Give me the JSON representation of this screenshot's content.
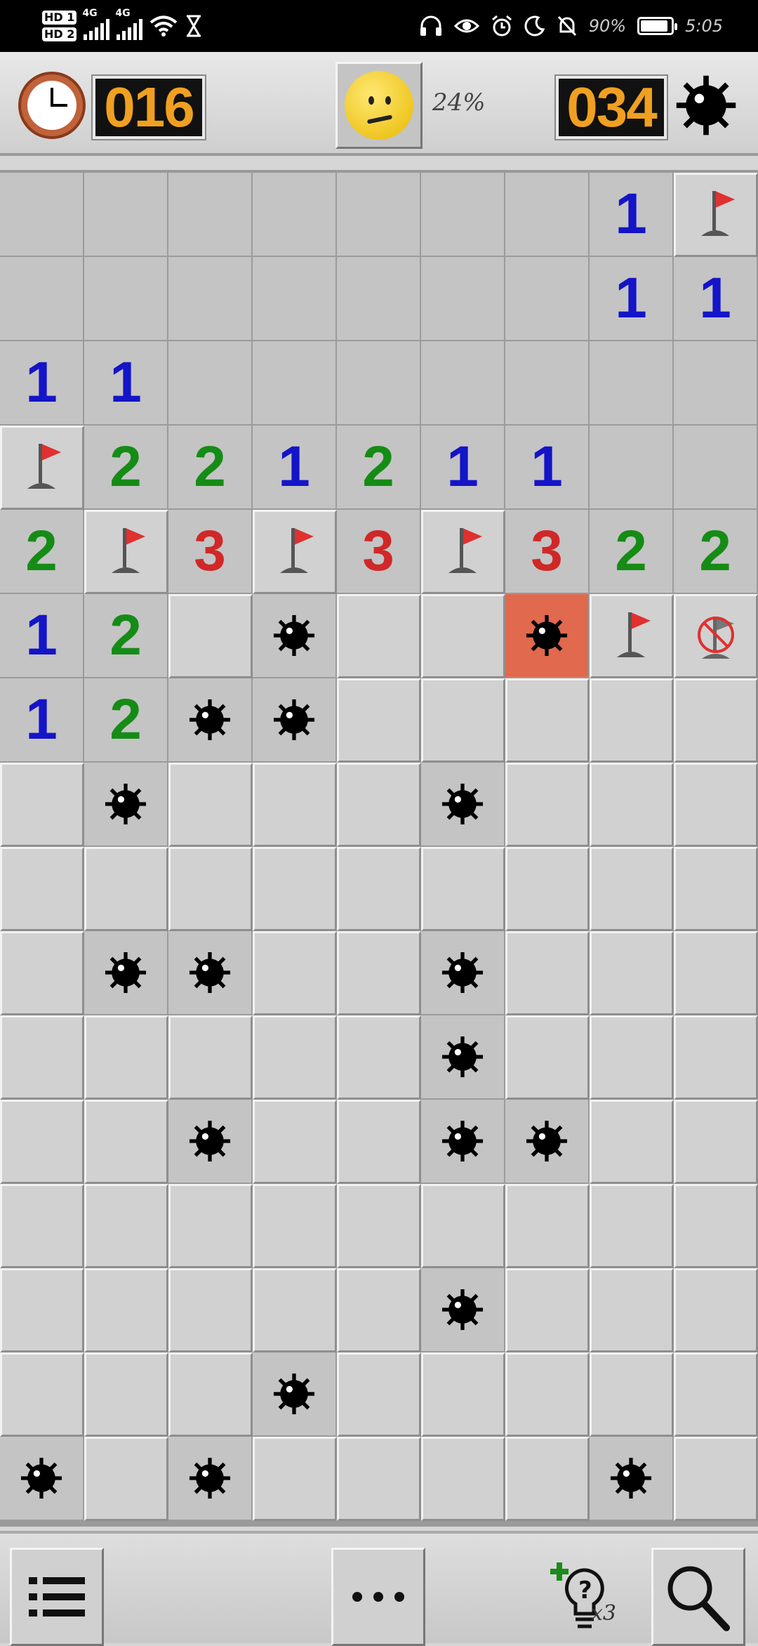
{
  "status_bar": {
    "hd1": "HD 1",
    "hd2": "HD 2",
    "net1": "4G",
    "net2": "4G",
    "battery_pct": "90%",
    "battery_level": 0.9,
    "time": "5:05"
  },
  "header": {
    "timer": "016",
    "progress": "24%",
    "mines_left": "034",
    "face_state": "worried"
  },
  "board": {
    "cols": 9,
    "rows": 16,
    "grid": [
      [
        "E",
        "E",
        "E",
        "E",
        "E",
        "E",
        "E",
        "1",
        "F"
      ],
      [
        "E",
        "E",
        "E",
        "E",
        "E",
        "E",
        "E",
        "1",
        "1"
      ],
      [
        "1",
        "1",
        "E",
        "E",
        "E",
        "E",
        "E",
        "E",
        "E"
      ],
      [
        "F",
        "2",
        "2",
        "1",
        "2",
        "1",
        "1",
        "E",
        "E"
      ],
      [
        "2",
        "F",
        "3",
        "F",
        "3",
        "F",
        "3",
        "2",
        "2"
      ],
      [
        "1",
        "2",
        "C",
        "M",
        "C",
        "C",
        "X",
        "F",
        "W"
      ],
      [
        "1",
        "2",
        "M",
        "M",
        "C",
        "C",
        "C",
        "C",
        "C"
      ],
      [
        "C",
        "M",
        "C",
        "C",
        "C",
        "M",
        "C",
        "C",
        "C"
      ],
      [
        "C",
        "C",
        "C",
        "C",
        "C",
        "C",
        "C",
        "C",
        "C"
      ],
      [
        "C",
        "M",
        "M",
        "C",
        "C",
        "M",
        "C",
        "C",
        "C"
      ],
      [
        "C",
        "C",
        "C",
        "C",
        "C",
        "M",
        "C",
        "C",
        "C"
      ],
      [
        "C",
        "C",
        "M",
        "C",
        "C",
        "M",
        "M",
        "C",
        "C"
      ],
      [
        "C",
        "C",
        "C",
        "C",
        "C",
        "C",
        "C",
        "C",
        "C"
      ],
      [
        "C",
        "C",
        "C",
        "C",
        "C",
        "M",
        "C",
        "C",
        "C"
      ],
      [
        "C",
        "C",
        "C",
        "M",
        "C",
        "C",
        "C",
        "C",
        "C"
      ],
      [
        "M",
        "C",
        "M",
        "C",
        "C",
        "C",
        "C",
        "M",
        "C"
      ]
    ]
  },
  "toolbar": {
    "menu_icon": "menu-list-icon",
    "more_icon": "more-dots-icon",
    "hint_icon": "hint-bulb-icon",
    "hint_count": "x3",
    "zoom_icon": "magnifier-icon"
  },
  "colors": {
    "n1": "#1414c8",
    "n2": "#158c15",
    "n3": "#d02828",
    "exploded": "#e0694e",
    "lcd_digits": "#f0a020"
  }
}
